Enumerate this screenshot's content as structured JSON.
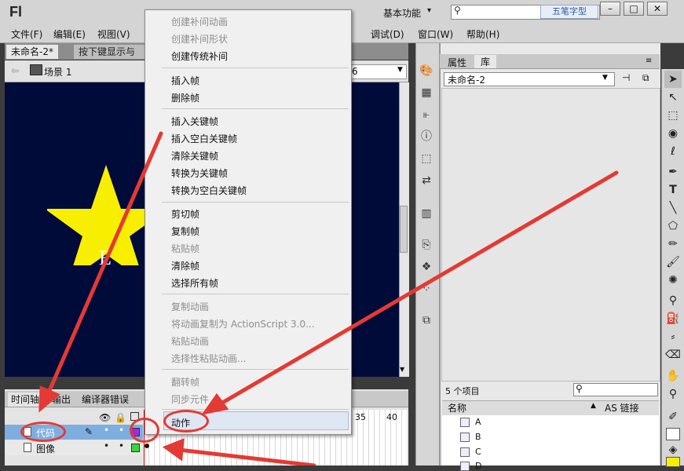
{
  "app": {
    "logo": "Fl",
    "workspace": "基本功能",
    "window_buttons": [
      "–",
      "□",
      "✕"
    ],
    "ime_badge": "五笔字型"
  },
  "menu": [
    "文件(F)",
    "编辑(E)",
    "视图(V)",
    "调试(D)",
    "窗口(W)",
    "帮助(H)"
  ],
  "document": {
    "tabs": [
      "未命名-2*",
      "按下键显示与"
    ],
    "scene": "场景 1",
    "stage_letter": "E",
    "zoom_fragment": "6"
  },
  "timeline": {
    "tabs": [
      "时间轴",
      "输出",
      "编译器错误"
    ],
    "frame_numbers": [
      "35",
      "40"
    ],
    "layers": [
      "代码",
      "图像"
    ]
  },
  "context_menu": {
    "groups": [
      [
        {
          "label": "创建补间动画",
          "disabled": true
        },
        {
          "label": "创建补间形状",
          "disabled": true
        },
        {
          "label": "创建传统补间",
          "disabled": false
        }
      ],
      [
        {
          "label": "插入帧",
          "disabled": false
        },
        {
          "label": "删除帧",
          "disabled": false
        }
      ],
      [
        {
          "label": "插入关键帧",
          "disabled": false
        },
        {
          "label": "插入空白关键帧",
          "disabled": false
        },
        {
          "label": "清除关键帧",
          "disabled": false
        },
        {
          "label": "转换为关键帧",
          "disabled": false
        },
        {
          "label": "转换为空白关键帧",
          "disabled": false
        }
      ],
      [
        {
          "label": "剪切帧",
          "disabled": false
        },
        {
          "label": "复制帧",
          "disabled": false
        },
        {
          "label": "粘贴帧",
          "disabled": true
        },
        {
          "label": "清除帧",
          "disabled": false
        },
        {
          "label": "选择所有帧",
          "disabled": false
        }
      ],
      [
        {
          "label": "复制动画",
          "disabled": true
        },
        {
          "label": "将动画复制为 ActionScript 3.0...",
          "disabled": true
        },
        {
          "label": "粘贴动画",
          "disabled": true
        },
        {
          "label": "选择性粘贴动画...",
          "disabled": true
        }
      ],
      [
        {
          "label": "翻转帧",
          "disabled": true
        },
        {
          "label": "同步元件",
          "disabled": true
        }
      ],
      [
        {
          "label": "动作",
          "disabled": false
        }
      ]
    ]
  },
  "library": {
    "tabs": [
      "属性",
      "库"
    ],
    "document_select": "未命名-2",
    "item_count": "5 个项目",
    "columns": [
      "名称",
      "AS 链接"
    ],
    "items": [
      "A",
      "B",
      "C",
      "D"
    ]
  },
  "colors": {
    "stage_bg": "#000b3a",
    "star": "#f8ef00",
    "annotation": "#e43a34",
    "selected_layer": "#7eaee0"
  }
}
